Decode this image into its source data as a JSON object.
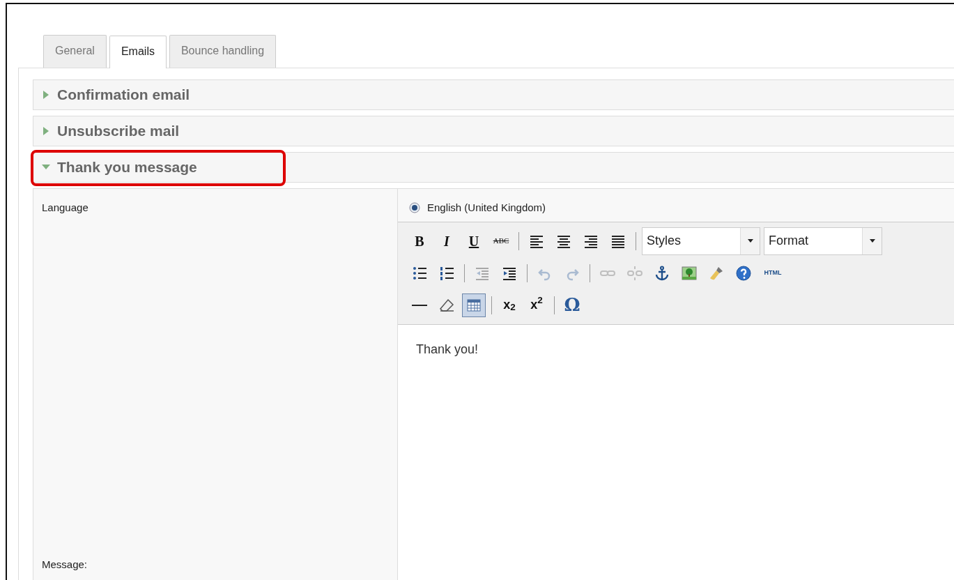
{
  "tabs": [
    {
      "label": "General",
      "selected": false
    },
    {
      "label": "Emails",
      "selected": true
    },
    {
      "label": "Bounce handling",
      "selected": false
    }
  ],
  "sections": [
    {
      "title": "Confirmation email",
      "expanded": false,
      "highlighted": false
    },
    {
      "title": "Unsubscribe mail",
      "expanded": false,
      "highlighted": false
    },
    {
      "title": "Thank you message",
      "expanded": true,
      "highlighted": true
    }
  ],
  "form": {
    "language_label": "Language",
    "message_label": "Message:",
    "languages": [
      {
        "label": "English (United Kingdom)",
        "selected": true
      }
    ],
    "toolbar_rows": [
      [
        {
          "kind": "bold",
          "label": "B",
          "disabled": false,
          "active": false
        },
        {
          "kind": "italic",
          "label": "I",
          "disabled": false,
          "active": false
        },
        {
          "kind": "underline",
          "label": "U",
          "disabled": false,
          "active": false
        },
        {
          "kind": "strike",
          "label": "ABC",
          "disabled": false,
          "active": false
        },
        {
          "kind": "separator"
        },
        {
          "kind": "align-left",
          "disabled": false,
          "active": false
        },
        {
          "kind": "align-center",
          "disabled": false,
          "active": false
        },
        {
          "kind": "align-right",
          "disabled": false,
          "active": false
        },
        {
          "kind": "align-justify",
          "disabled": false,
          "active": false
        },
        {
          "kind": "separator"
        },
        {
          "kind": "select",
          "label": "Styles"
        },
        {
          "kind": "select",
          "label": "Format"
        }
      ],
      [
        {
          "kind": "bullet-list",
          "disabled": false,
          "active": false
        },
        {
          "kind": "number-list",
          "disabled": false,
          "active": false
        },
        {
          "kind": "separator"
        },
        {
          "kind": "outdent",
          "disabled": true,
          "active": false
        },
        {
          "kind": "indent",
          "disabled": false,
          "active": false
        },
        {
          "kind": "separator"
        },
        {
          "kind": "undo",
          "disabled": true,
          "active": false
        },
        {
          "kind": "redo",
          "disabled": true,
          "active": false
        },
        {
          "kind": "separator"
        },
        {
          "kind": "link",
          "disabled": true,
          "active": false
        },
        {
          "kind": "unlink",
          "disabled": true,
          "active": false
        },
        {
          "kind": "anchor",
          "disabled": false,
          "active": false
        },
        {
          "kind": "image",
          "disabled": false,
          "active": false
        },
        {
          "kind": "brush",
          "disabled": false,
          "active": false
        },
        {
          "kind": "help",
          "disabled": false,
          "active": false
        },
        {
          "kind": "html",
          "label": "HTML",
          "disabled": false,
          "active": false
        }
      ],
      [
        {
          "kind": "rule",
          "disabled": false,
          "active": false
        },
        {
          "kind": "eraser",
          "disabled": false,
          "active": false
        },
        {
          "kind": "table",
          "disabled": false,
          "active": true
        },
        {
          "kind": "separator"
        },
        {
          "kind": "subscript",
          "label": "x$_{2}$",
          "disabled": false,
          "active": false
        },
        {
          "kind": "superscript",
          "label": "x$^{2}$",
          "disabled": false,
          "active": false
        },
        {
          "kind": "separator"
        },
        {
          "kind": "charmap",
          "label": "Ω",
          "disabled": false,
          "active": false
        }
      ]
    ],
    "message_text": "Thank you!"
  }
}
